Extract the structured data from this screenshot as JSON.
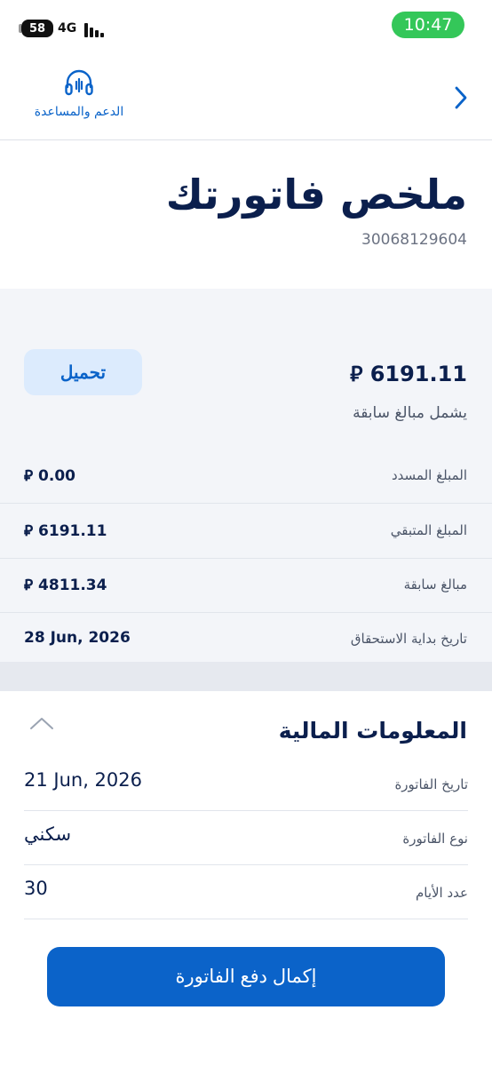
{
  "status": {
    "battery": "58",
    "network": "4G",
    "time": "10:47"
  },
  "header": {
    "support_label": "الدعم والمساعدة",
    "icons": {
      "back": "chevron-right-icon",
      "support": "headset-icon"
    }
  },
  "title": {
    "text": "ملخص فاتورتك",
    "invoice_number": "30068129604"
  },
  "summary": {
    "total": "6191.11",
    "currency_symbol": "⃁",
    "download_label": "تحميل",
    "note": "يشمل مبالغ سابقة",
    "rows": [
      {
        "label": "المبلغ المسدد",
        "value": "0.00"
      },
      {
        "label": "المبلغ المتبقي",
        "value": "6191.11"
      },
      {
        "label": "مبالغ سابقة",
        "value": "4811.34"
      },
      {
        "label": "تاريخ بداية الاستحقاق",
        "value": "28 Jun, 2026"
      }
    ]
  },
  "financial": {
    "title": "المعلومات المالية",
    "rows": [
      {
        "label": "تاريخ الفاتورة",
        "value": "21 Jun, 2026"
      },
      {
        "label": "نوع الفاتورة",
        "value": "سكني"
      },
      {
        "label": "عدد الأيام",
        "value": "30"
      }
    ]
  },
  "pay_button": {
    "label": "إكمال دفع الفاتورة"
  },
  "colors": {
    "accent": "#0b63c9",
    "navy": "#0b1f4d",
    "time_pill": "#34c759"
  }
}
